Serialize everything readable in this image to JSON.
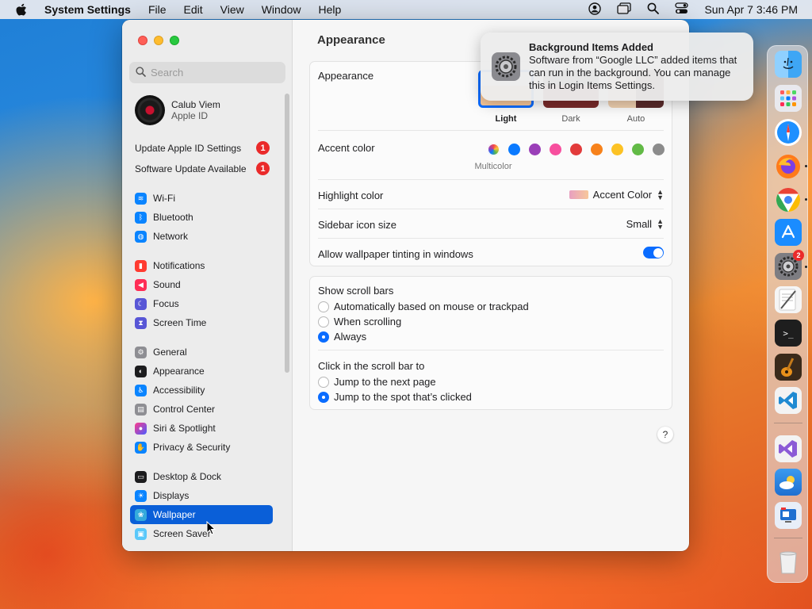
{
  "menubar": {
    "app_name": "System Settings",
    "menus": [
      "File",
      "Edit",
      "View",
      "Window",
      "Help"
    ],
    "clock": "Sun Apr 7  3:46 PM"
  },
  "sidebar": {
    "search_placeholder": "Search",
    "profile": {
      "name": "Calub Viem",
      "subtitle": "Apple ID"
    },
    "alerts": [
      {
        "label": "Update Apple ID Settings",
        "count": "1"
      },
      {
        "label": "Software Update Available",
        "count": "1"
      }
    ],
    "groups": [
      [
        {
          "label": "Wi-Fi",
          "icon": "wifi-icon",
          "color": "#0a84ff"
        },
        {
          "label": "Bluetooth",
          "icon": "bluetooth-icon",
          "color": "#0a84ff"
        },
        {
          "label": "Network",
          "icon": "globe-icon",
          "color": "#0a84ff"
        }
      ],
      [
        {
          "label": "Notifications",
          "icon": "bell-icon",
          "color": "#ff3b30"
        },
        {
          "label": "Sound",
          "icon": "speaker-icon",
          "color": "#ff2d55"
        },
        {
          "label": "Focus",
          "icon": "moon-icon",
          "color": "#5856d6"
        },
        {
          "label": "Screen Time",
          "icon": "hourglass-icon",
          "color": "#5856d6"
        }
      ],
      [
        {
          "label": "General",
          "icon": "gear-icon",
          "color": "#8e8e93"
        },
        {
          "label": "Appearance",
          "icon": "appearance-icon",
          "color": "#1c1c1e"
        },
        {
          "label": "Accessibility",
          "icon": "accessibility-icon",
          "color": "#0a84ff"
        },
        {
          "label": "Control Center",
          "icon": "control-center-icon",
          "color": "#8e8e93"
        },
        {
          "label": "Siri & Spotlight",
          "icon": "siri-icon",
          "color": "#2c2c4e"
        },
        {
          "label": "Privacy & Security",
          "icon": "hand-icon",
          "color": "#0a84ff"
        }
      ],
      [
        {
          "label": "Desktop & Dock",
          "icon": "dock-icon",
          "color": "#1c1c1e"
        },
        {
          "label": "Displays",
          "icon": "display-icon",
          "color": "#0a84ff"
        },
        {
          "label": "Wallpaper",
          "icon": "wallpaper-icon",
          "color": "#34aadc",
          "selected": true
        },
        {
          "label": "Screen Saver",
          "icon": "screen-saver-icon",
          "color": "#5ac8fa"
        }
      ]
    ]
  },
  "main": {
    "title": "Appearance",
    "appearance_label": "Appearance",
    "themes": [
      {
        "label": "Light",
        "selected": true
      },
      {
        "label": "Dark",
        "selected": false
      },
      {
        "label": "Auto",
        "selected": false
      }
    ],
    "accent_label": "Accent color",
    "accent_colors": [
      "#a0a0ff",
      "#0a7aff",
      "#9a3fb8",
      "#f74f9e",
      "#e23b3b",
      "#f7821b",
      "#fcc224",
      "#62ba46",
      "#8c8c8c"
    ],
    "accent_selected_label": "Multicolor",
    "highlight_label": "Highlight color",
    "highlight_value": "Accent Color",
    "sidebar_icon_label": "Sidebar icon size",
    "sidebar_icon_value": "Small",
    "tinting_label": "Allow wallpaper tinting in windows",
    "tinting_on": true,
    "scroll_title": "Show scroll bars",
    "scroll_options": [
      {
        "label": "Automatically based on mouse or trackpad",
        "selected": false
      },
      {
        "label": "When scrolling",
        "selected": false
      },
      {
        "label": "Always",
        "selected": true
      }
    ],
    "click_title": "Click in the scroll bar to",
    "click_options": [
      {
        "label": "Jump to the next page",
        "selected": false
      },
      {
        "label": "Jump to the spot that’s clicked",
        "selected": true
      }
    ],
    "help": "?"
  },
  "notification": {
    "title": "Background Items Added",
    "body": "Software from “Google LLC” added items that can run in the background. You can manage this in Login Items Settings."
  },
  "dock": [
    {
      "name": "finder-icon",
      "color": "#3ea6f5"
    },
    {
      "name": "launchpad-icon",
      "color": "#e9e9ee"
    },
    {
      "name": "safari-icon",
      "color": "#1e90ff"
    },
    {
      "name": "firefox-icon",
      "color": "#ff7a1a"
    },
    {
      "name": "chrome-icon",
      "color": "#ffffff"
    },
    {
      "name": "app-store-icon",
      "color": "#1a8cff"
    },
    {
      "name": "system-settings-icon",
      "color": "#7d7d82",
      "badge": "2"
    },
    {
      "name": "textedit-icon",
      "color": "#f1f1f1"
    },
    {
      "name": "terminal-icon",
      "color": "#1e1e1e"
    },
    {
      "name": "garageband-icon",
      "color": "#3a2a1a"
    },
    {
      "name": "vscode-icon",
      "color": "#1f8ad2"
    },
    {
      "name": "visual-studio-icon",
      "color": "#8b5bd6"
    },
    {
      "name": "weather-icon",
      "color": "#2e86de"
    },
    {
      "name": "remote-desktop-icon",
      "color": "#e8eef8"
    },
    {
      "name": "trash-icon",
      "color": "#dcdcdc"
    }
  ]
}
